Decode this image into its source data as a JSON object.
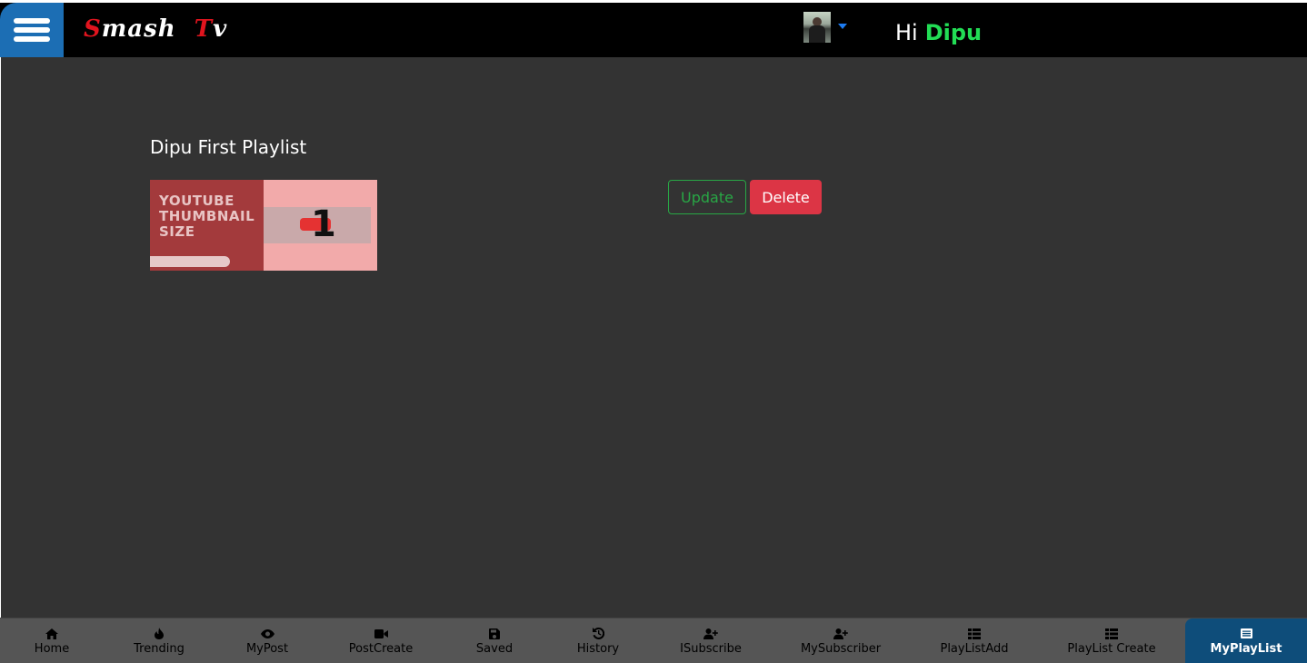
{
  "header": {
    "logo_first_letter": "S",
    "logo_rest_one": "mash",
    "logo_second_letter": "T",
    "logo_rest_two": "v",
    "greeting": "Hi",
    "user_name": "Dipu"
  },
  "playlist": {
    "title": "Dipu First Playlist",
    "thumbnail_text_line1": "YOUTUBE",
    "thumbnail_text_line2": "THUMBNAIL",
    "thumbnail_text_line3": "SIZE",
    "update_label": "Update",
    "delete_label": "Delete"
  },
  "bottom_nav": {
    "items": [
      {
        "label": "Home",
        "icon": "home-icon"
      },
      {
        "label": "Trending",
        "icon": "fire-icon"
      },
      {
        "label": "MyPost",
        "icon": "eye-icon"
      },
      {
        "label": "PostCreate",
        "icon": "video-icon"
      },
      {
        "label": "Saved",
        "icon": "save-icon"
      },
      {
        "label": "History",
        "icon": "history-icon"
      },
      {
        "label": "ISubscribe",
        "icon": "user-plus-icon"
      },
      {
        "label": "MySubscriber",
        "icon": "user-plus-icon"
      },
      {
        "label": "PlayListAdd",
        "icon": "list-icon"
      },
      {
        "label": "PlayList Create",
        "icon": "list-icon"
      },
      {
        "label": "MyPlayList",
        "icon": "list-alt-icon"
      }
    ],
    "active": "MyPlayList"
  },
  "colors": {
    "accent_blue": "#1c6eb4",
    "active_nav": "#0e4d7a",
    "username_green": "#22dd55",
    "logo_red": "#e0141e",
    "update_green": "#28a745",
    "delete_red": "#dc3545",
    "content_bg": "#333333"
  }
}
